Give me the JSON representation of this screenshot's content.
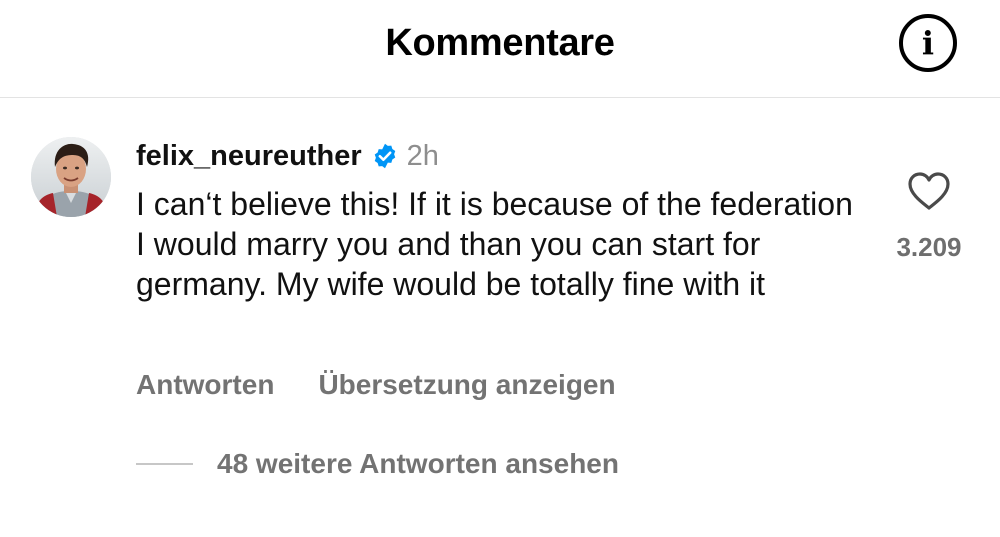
{
  "header": {
    "title": "Kommentare",
    "info_icon": "info-circle-icon"
  },
  "comment": {
    "username": "felix_neureuther",
    "verified_icon": "verified-badge-icon",
    "timestamp": "2h",
    "text": "I can‘t believe this! If it is because of the federation I would marry you and than you can start for germany. My wife would be totally fine with it",
    "like_icon": "heart-outline-icon",
    "like_count": "3.209",
    "actions": {
      "reply": "Antworten",
      "translate": "Übersetzung anzeigen"
    },
    "replies_label": "48 weitere Antworten ansehen"
  },
  "colors": {
    "text_primary": "#111111",
    "text_secondary": "#737373",
    "verified_blue": "#0095f6",
    "divider": "#e3e3e3"
  }
}
